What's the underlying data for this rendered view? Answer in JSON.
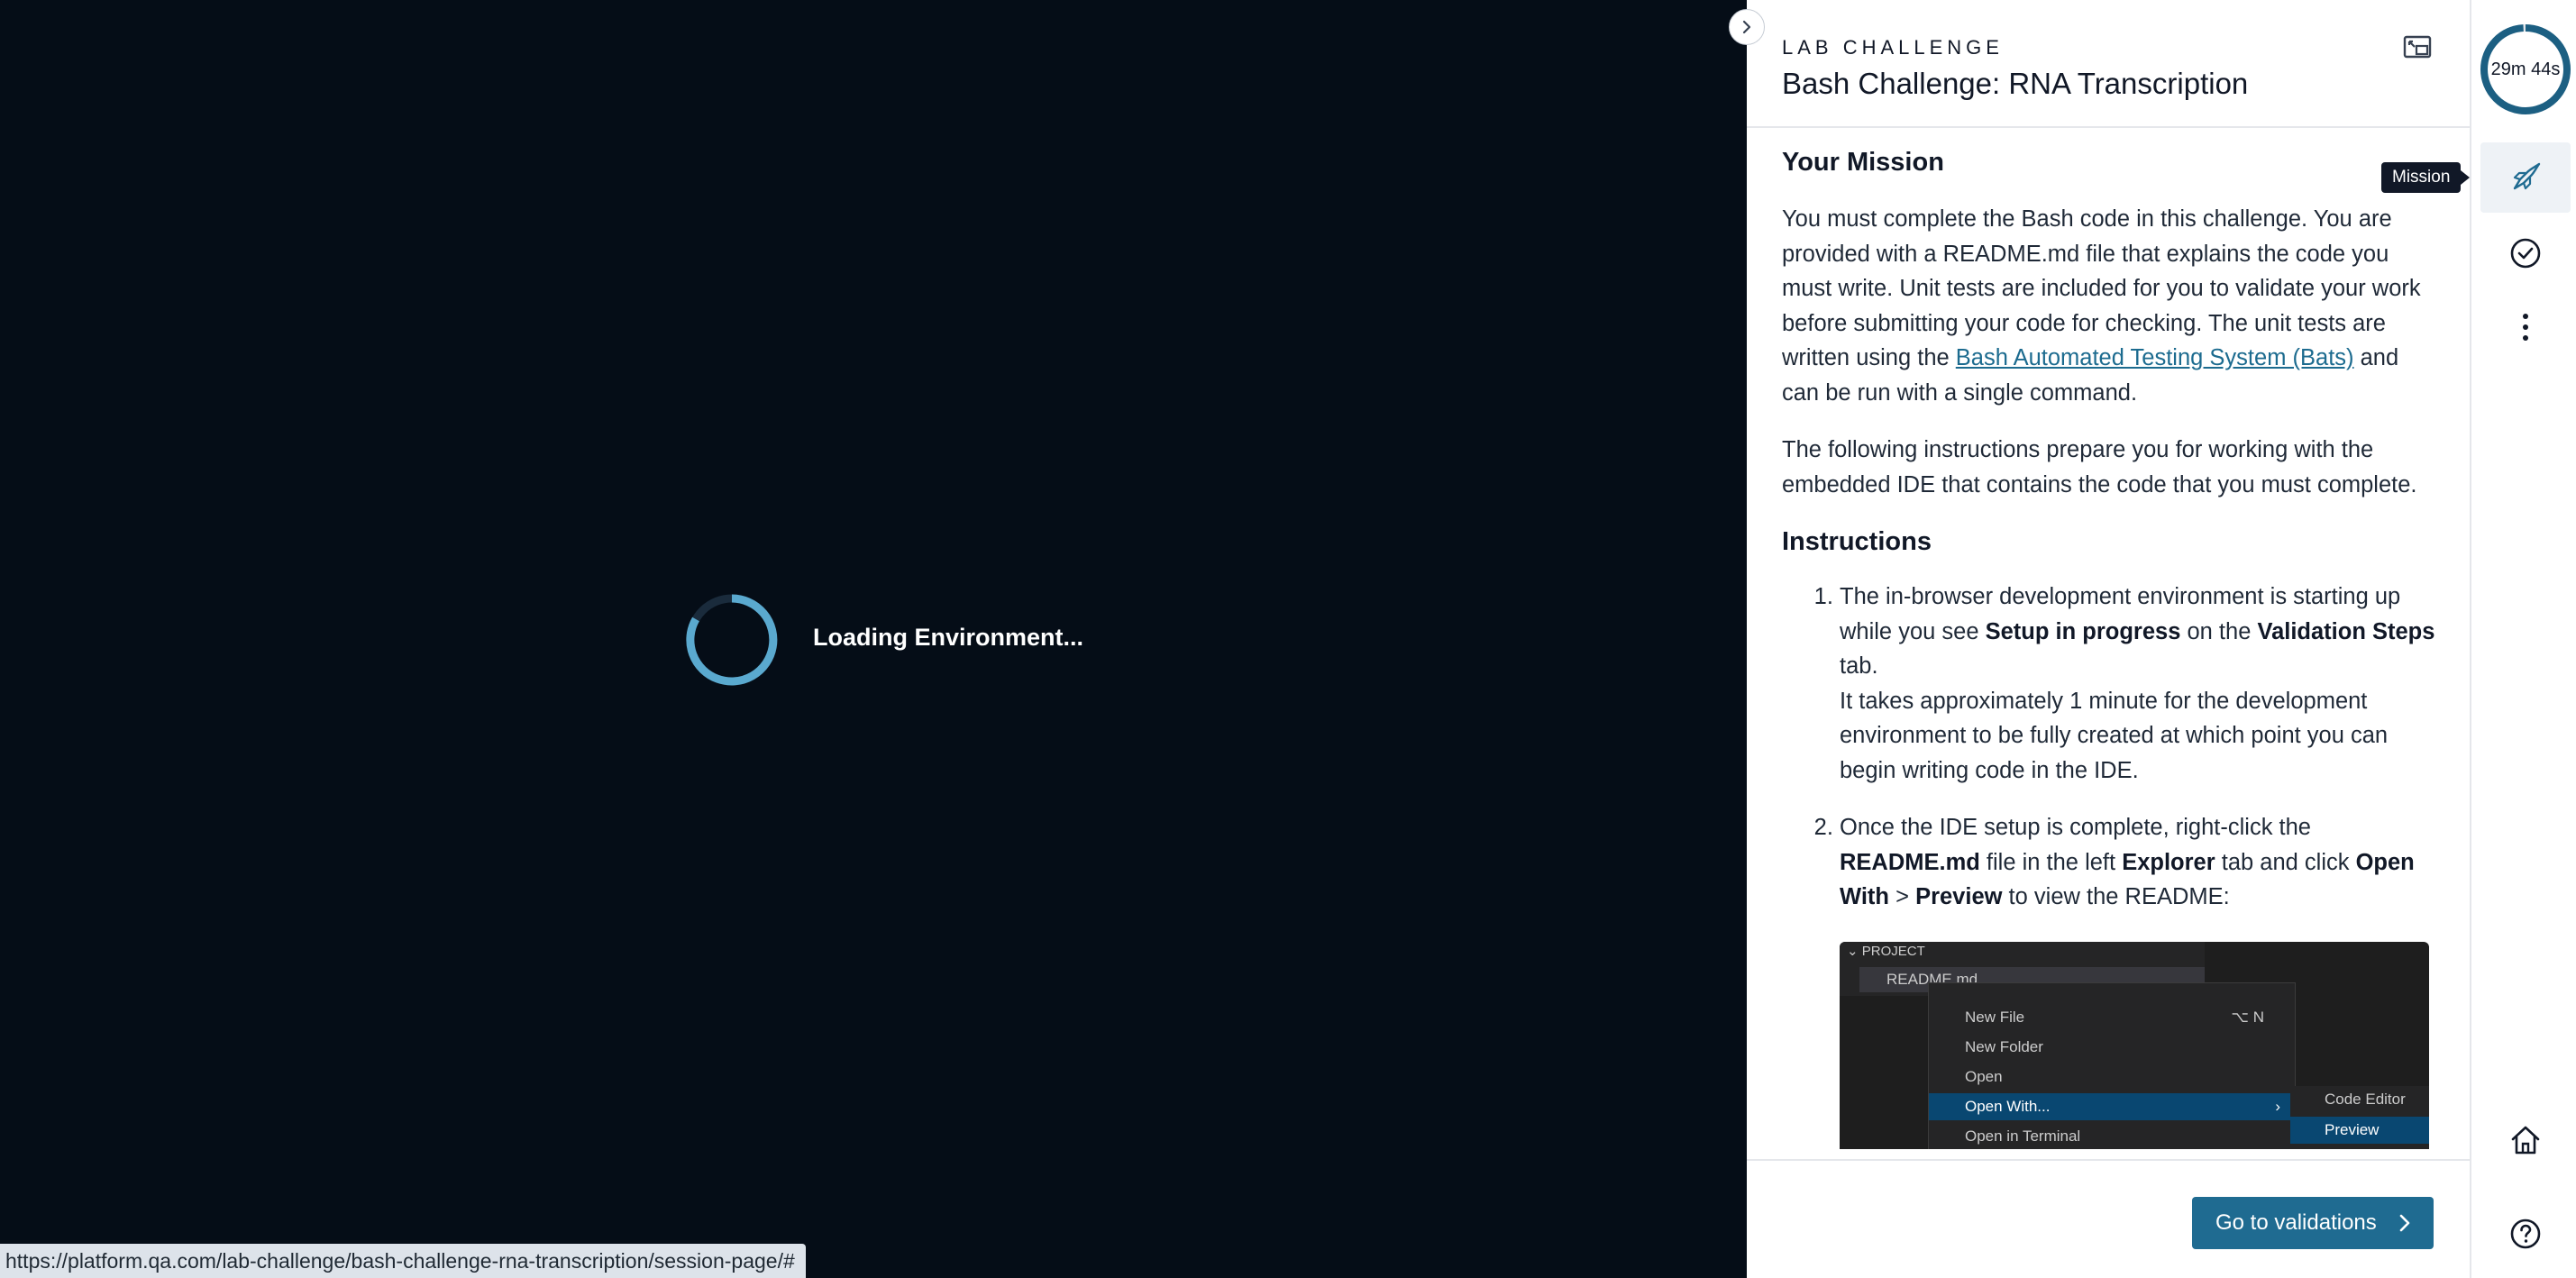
{
  "environment": {
    "loading_text": "Loading Environment...",
    "status_url": "https://platform.qa.com/lab-challenge/bash-challenge-rna-transcription/session-page/#"
  },
  "header": {
    "eyebrow": "LAB CHALLENGE",
    "title": "Bash Challenge: RNA Transcription"
  },
  "mission": {
    "heading": "Your Mission",
    "p1_before": "You must complete the Bash code in this challenge. You are provided with a README.md file that explains the code you must write. Unit tests are included for you to validate your work before submitting your code for checking. The unit tests are written using the ",
    "p1_link": "Bash Automated Testing System (Bats)",
    "p1_after": " and can be run with a single command.",
    "p2": "The following instructions prepare you for working with the embedded IDE that contains the code that you must complete."
  },
  "instructions": {
    "heading": "Instructions",
    "step1": {
      "a": "The in-browser development environment is starting up while you see ",
      "b_setup": "Setup in progress",
      "c": " on the ",
      "d_validation": "Validation Steps",
      "e": " tab.",
      "note": "It takes approximately 1 minute for the development environment to be fully created at which point you can begin writing code in the IDE."
    },
    "step2": {
      "a": "Once the IDE setup is complete, right-click the ",
      "b_readme": "README.md",
      "c": " file in the left ",
      "d_explorer": "Explorer",
      "e": " tab and click ",
      "f_openwith": "Open With",
      "g": " > ",
      "h_preview": "Preview",
      "i": " to view the README:"
    }
  },
  "screenshot": {
    "project_label": "PROJECT",
    "file_name": "README.md",
    "menu_items": [
      "New File",
      "New Folder",
      "Open",
      "Open With...",
      "Open in Terminal"
    ],
    "new_file_shortcut": "⌥ N",
    "submenu_items": [
      "Code Editor",
      "Preview"
    ]
  },
  "footer": {
    "go_label": "Go to validations"
  },
  "rail": {
    "timer": "29m 44s",
    "timer_fraction_remaining": 0.99,
    "tooltip": "Mission"
  },
  "colors": {
    "accent": "#1f6b91",
    "timer_ring": "#1c5f82",
    "spinner": "#5aa9cf"
  }
}
